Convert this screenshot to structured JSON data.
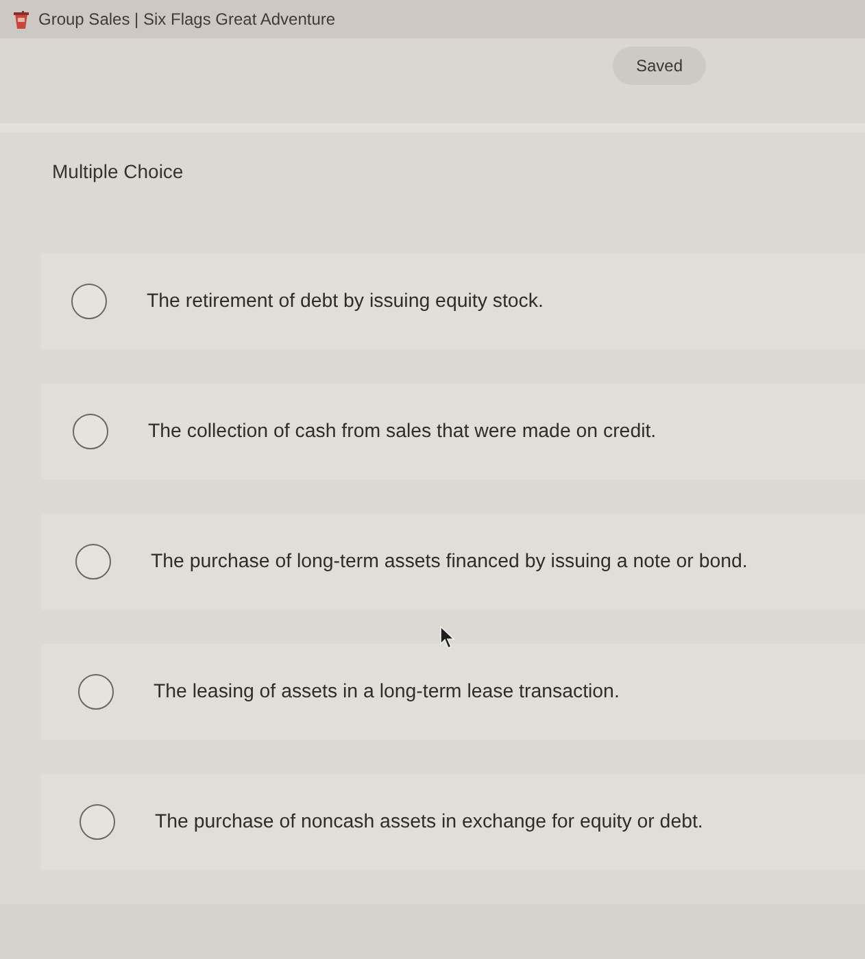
{
  "tab": {
    "title": "Group Sales | Six Flags Great Adventure"
  },
  "status": {
    "label": "Saved"
  },
  "question": {
    "type_label": "Multiple Choice",
    "options": [
      {
        "text": "The retirement of debt by issuing equity stock.",
        "selected": false
      },
      {
        "text": "The collection of cash from sales that were made on credit.",
        "selected": false
      },
      {
        "text": "The purchase of long-term assets financed by issuing a note or bond.",
        "selected": false
      },
      {
        "text": "The leasing of assets in a long-term lease transaction.",
        "selected": false
      },
      {
        "text": "The purchase of noncash assets in exchange for equity or debt.",
        "selected": false
      }
    ]
  }
}
